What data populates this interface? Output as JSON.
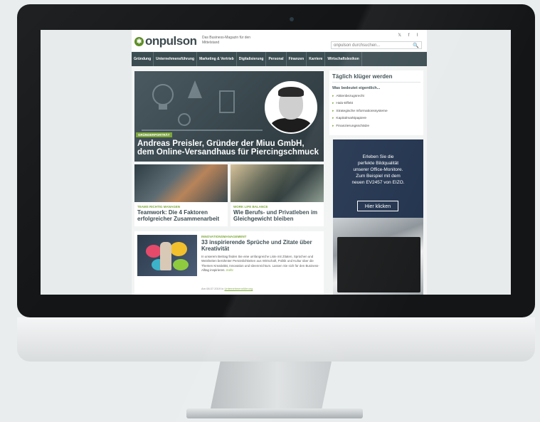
{
  "site": {
    "logo_text": "onpulson",
    "logo_mark": "✱",
    "tagline": "Das Business-Magazin für den Mittelstand",
    "social_icons": [
      "twitter-icon",
      "facebook-icon",
      "rss-icon"
    ],
    "social_glyphs": "𝕏 f ⌇",
    "search_placeholder": "onpulson durchsuchen...",
    "search_icon": "🔍"
  },
  "nav": {
    "items": [
      "Gründung",
      "Unternehmensführung",
      "Marketing & Vertrieb",
      "Digitalisierung",
      "Personal",
      "Finanzen",
      "Karriere",
      "Wirtschaftslexikon"
    ]
  },
  "hero": {
    "tag": "GRÜNDERPORTRÄT",
    "title": "Andreas Preisler, Gründer der Miuu GmbH, dem Online-Versandhaus für Piercingschmuck"
  },
  "cards": [
    {
      "tag": "TEAMS RICHTIG MANAGEN",
      "title": "Teamwork: Die 4 Faktoren erfolgreicher Zusammenarbeit"
    },
    {
      "tag": "WORK LIFE BALANCE",
      "title": "Wie Berufs- und Privatleben im Gleichgewicht bleiben"
    }
  ],
  "article": {
    "tag": "INNOVATIONSMANAGEMENT",
    "title": "33 inspirierende Sprüche und Zitate über Kreativität",
    "text": "In unserem Beitrag finden Sie eine umfangreiche Liste mit Zitaten, Sprüchen und Weisheiten berühmter Persönlichkeiten aus Wirtschaft, Politik und Kultur über die Themen Kreativität, Innovation und Ideenreichtum. Lassen Sie sich für den Business-Alltag inspirieren.",
    "more": "mehr",
    "meta_prefix": "Am 08.07.2019 in",
    "meta_link": "Unternehmensführung"
  },
  "sidebar": {
    "title": "Täglich klüger werden",
    "subtitle": "Was bedeutet eigentlich...",
    "items": [
      "Aktienbezugsrecht",
      "Halo-Effekt",
      "Strategische Informationssysteme",
      "Kapitalmarktpapiere",
      "Finanzierungsschätze"
    ]
  },
  "ad": {
    "lines": [
      "Erleben Sie die",
      "perfekte Bildqualität",
      "unserer Office-Monitore.",
      "Zum Beispiel mit dem",
      "neuen EV2457 von EIZO."
    ],
    "button": "Hier klicken"
  },
  "colors": {
    "accent": "#7da73a",
    "nav_bg": "#3c4d52",
    "ad_bg": "#23344f"
  }
}
